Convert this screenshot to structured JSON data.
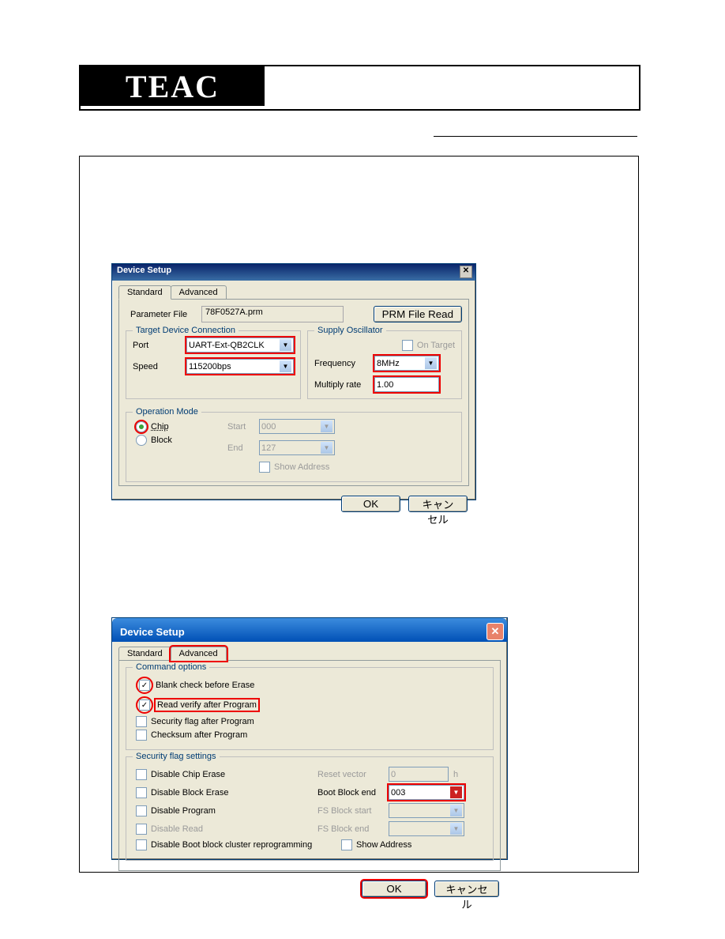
{
  "logo_text": "TEAC",
  "dialog1": {
    "title": "Device Setup",
    "tabs": {
      "standard": "Standard",
      "advanced": "Advanced"
    },
    "param_file_label": "Parameter File",
    "param_file_value": "78F0527A.prm",
    "prm_file_read_btn": "PRM File Read",
    "target_group": "Target Device Connection",
    "port_label": "Port",
    "port_value": "UART-Ext-QB2CLK",
    "speed_label": "Speed",
    "speed_value": "115200bps",
    "supply_group": "Supply Oscillator",
    "on_target_label": "On Target",
    "frequency_label": "Frequency",
    "frequency_value": "8MHz",
    "multiply_label": "Multiply rate",
    "multiply_value": "1.00",
    "operation_group": "Operation Mode",
    "chip_label": "Chip",
    "block_label": "Block",
    "start_label": "Start",
    "start_value": "000",
    "end_label": "End",
    "end_value": "127",
    "show_address_label": "Show Address",
    "ok_btn": "OK",
    "cancel_btn": "キャンセル"
  },
  "dialog2": {
    "title": "Device Setup",
    "tabs": {
      "standard": "Standard",
      "advanced": "Advanced"
    },
    "cmd_options_group": "Command options",
    "blank_check": "Blank check before Erase",
    "read_verify": "Read verify after Program",
    "security_after": "Security flag after Program",
    "checksum_after": "Checksum after Program",
    "sec_flag_group": "Security flag settings",
    "disable_chip_erase": "Disable Chip Erase",
    "disable_block_erase": "Disable Block Erase",
    "disable_program": "Disable Program",
    "disable_read": "Disable Read",
    "disable_boot": "Disable Boot block cluster reprogramming",
    "reset_vector": "Reset vector",
    "reset_vector_val": "0",
    "reset_vector_h": "h",
    "boot_block_end": "Boot Block end",
    "boot_block_end_val": "003",
    "fs_block_start": "FS Block start",
    "fs_block_end": "FS Block end",
    "show_address": "Show Address",
    "ok_btn": "OK",
    "cancel_btn": "キャンセル"
  }
}
